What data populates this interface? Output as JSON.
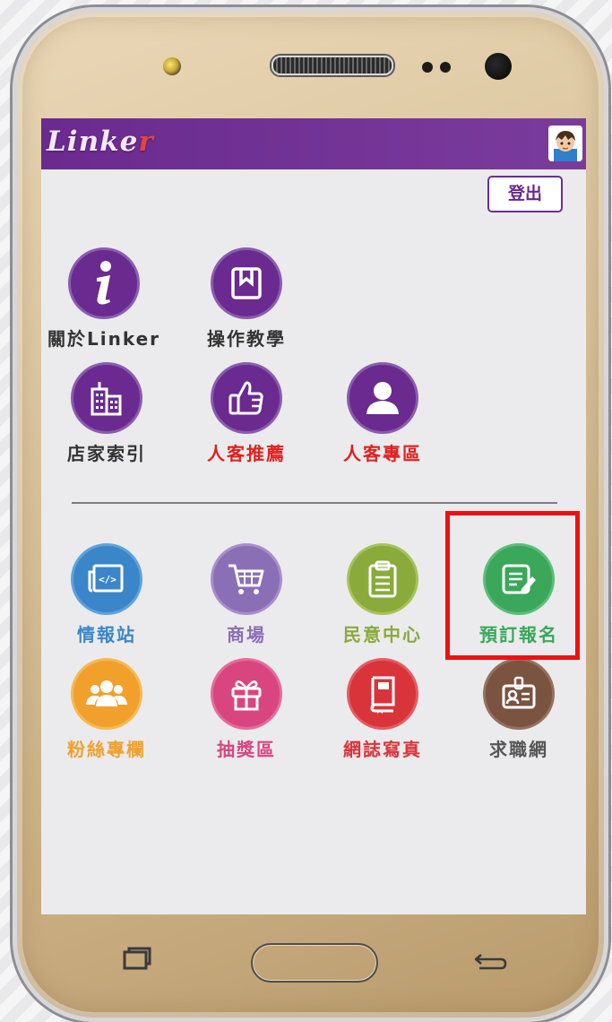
{
  "app": {
    "logo_text_main": "Linke",
    "logo_text_accent": "r"
  },
  "header": {
    "logout_label": "登出"
  },
  "colors": {
    "brand_purple": "#6a2a8f",
    "red_label": "#e0201f",
    "news_blue": "#3b86c9",
    "mall_lilac": "#8b6fb6",
    "opinion_olive": "#8aaa3c",
    "booking_green": "#3aa75a",
    "fans_orange": "#f1a02b",
    "lottery_pink": "#d9467f",
    "journal_red": "#d9343a",
    "job_brown": "#7b5341",
    "highlight_box": "#ee1111"
  },
  "menu_top": [
    {
      "label": "關於Linker",
      "icon": "info-icon"
    },
    {
      "label": "操作教學",
      "icon": "book-bookmark-icon"
    },
    {
      "label": "店家索引",
      "icon": "buildings-icon"
    },
    {
      "label": "人客推薦",
      "icon": "thumbs-up-icon"
    },
    {
      "label": "人客專區",
      "icon": "user-icon"
    }
  ],
  "menu_bottom": [
    {
      "label": "情報站",
      "icon": "newspaper-icon"
    },
    {
      "label": "商場",
      "icon": "shopping-cart-icon"
    },
    {
      "label": "民意中心",
      "icon": "clipboard-icon"
    },
    {
      "label": "預訂報名",
      "icon": "form-edit-icon"
    },
    {
      "label": "粉絲專欄",
      "icon": "group-icon"
    },
    {
      "label": "抽獎區",
      "icon": "gift-icon"
    },
    {
      "label": "網誌寫真",
      "icon": "journal-icon"
    },
    {
      "label": "求職網",
      "icon": "id-badge-icon"
    }
  ],
  "nav_buttons": {
    "recent": "recent-apps-icon",
    "home": "home-button",
    "back": "back-arrow-icon"
  }
}
